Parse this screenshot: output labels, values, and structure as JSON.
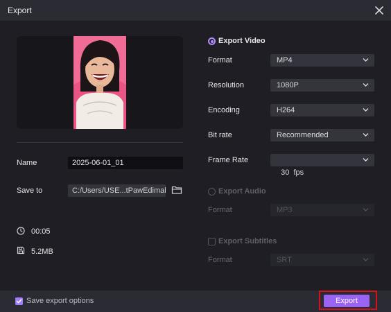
{
  "window": {
    "title": "Export"
  },
  "left": {
    "name_label": "Name",
    "name_value": "2025-06-01_01",
    "saveto_label": "Save to",
    "saveto_value": "C:/Users/USE...tPawEdimakor",
    "duration": "00:05",
    "size": "5.2MB"
  },
  "video": {
    "title": "Export Video",
    "selected": true,
    "rows": [
      {
        "label": "Format",
        "value": "MP4"
      },
      {
        "label": "Resolution",
        "value": "1080P"
      },
      {
        "label": "Encoding",
        "value": "H264"
      },
      {
        "label": "Bit rate",
        "value": "Recommended"
      },
      {
        "label": "Frame Rate",
        "value": "30  fps"
      }
    ]
  },
  "audio": {
    "title": "Export Audio",
    "selected": false,
    "format_label": "Format",
    "format_value": "MP3"
  },
  "subtitles": {
    "title": "Export Subtitles",
    "checked": false,
    "format_label": "Format",
    "format_value": "SRT"
  },
  "footer": {
    "save_options_label": "Save export options",
    "save_options_checked": true,
    "export_label": "Export"
  },
  "colors": {
    "accent": "#9a63f4",
    "highlight": "#d6111c",
    "background": "#1e1e24",
    "panel": "#2b2b33"
  }
}
